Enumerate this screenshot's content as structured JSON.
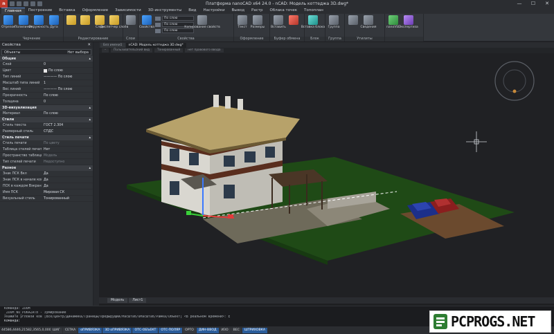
{
  "titlebar": {
    "title": "Платформа nanoCAD x64 24.0 - nCAD: Модель коттеджа 3D.dwg*",
    "app_icon": "nanocad-logo",
    "minimize": "—",
    "maximize": "☐",
    "close": "✕"
  },
  "ribbon_tabs": [
    "Главная",
    "Построение",
    "Вставка",
    "Оформление",
    "Зависимости",
    "3D-инструменты",
    "Вид",
    "Настройки",
    "Вывод",
    "Растр",
    "Облака точек",
    "Топоплан"
  ],
  "ribbon": {
    "groups": [
      {
        "label": "Черчение",
        "buttons": [
          {
            "label": "Отрезок",
            "icon": "line-icon",
            "color": "blue"
          },
          {
            "label": "Полилиния",
            "icon": "polyline-icon",
            "color": "blue"
          },
          {
            "label": "Окружность",
            "icon": "circle-icon",
            "color": "blue"
          },
          {
            "label": "Дуга",
            "icon": "arc-icon",
            "color": "blue"
          }
        ]
      },
      {
        "label": "Редактирование",
        "buttons": [
          {
            "label": "",
            "icon": "move-icon",
            "color": "yellow"
          },
          {
            "label": "",
            "icon": "rotate-icon",
            "color": "yellow"
          },
          {
            "label": "Слои",
            "icon": "layers-icon",
            "color": "yellow"
          },
          {
            "label": "Диспетчер слоёв",
            "icon": "layer-manager-icon",
            "color": "yellow"
          }
        ]
      },
      {
        "label": "Слои",
        "buttons": [
          {
            "label": "",
            "icon": "layer-props-icon",
            "color": "gray"
          }
        ]
      },
      {
        "label": "Свойства",
        "combos": [
          "По слою",
          "По слою",
          "По слою"
        ],
        "buttons": [
          {
            "label": "Свойства",
            "icon": "properties-icon",
            "color": "blue"
          },
          {
            "label": "Копирование свойств",
            "icon": "match-props-icon",
            "color": "gray"
          }
        ]
      },
      {
        "label": "Оформление",
        "buttons": [
          {
            "label": "Текст",
            "icon": "text-icon",
            "color": "gray"
          },
          {
            "label": "Размеры",
            "icon": "dimension-icon",
            "color": "gray"
          }
        ]
      },
      {
        "label": "Буфер обмена",
        "buttons": [
          {
            "label": "Вставить",
            "icon": "paste-icon",
            "color": "gray"
          },
          {
            "label": "",
            "icon": "cut-icon",
            "color": "red"
          }
        ]
      },
      {
        "label": "Блок",
        "buttons": [
          {
            "label": "Вставка блока",
            "icon": "insert-block-icon",
            "color": "teal"
          }
        ]
      },
      {
        "label": "Группа",
        "buttons": [
          {
            "label": "Группа",
            "icon": "group-icon",
            "color": "gray"
          }
        ]
      },
      {
        "label": "Утилиты",
        "buttons": [
          {
            "label": "",
            "icon": "measure-icon",
            "color": "gray"
          },
          {
            "label": "Сведения",
            "icon": "info-icon",
            "color": "gray"
          }
        ]
      },
      {
        "label": "",
        "buttons": [
          {
            "label": "nanoVSE",
            "icon": "nanovse-icon",
            "color": "green"
          },
          {
            "label": "Экспертиза",
            "icon": "expert-icon",
            "color": "purple"
          }
        ]
      }
    ]
  },
  "properties": {
    "header": "Свойства",
    "close": "✕",
    "selection": "Нет выбора",
    "selection_label": "Объекты",
    "sections": [
      {
        "title": "Общие",
        "rows": [
          {
            "k": "Слой",
            "v": "0"
          },
          {
            "k": "Цвет",
            "v": "По слою",
            "swatch": true
          },
          {
            "k": "Тип линий",
            "v": "———— По слою"
          },
          {
            "k": "Масштаб типа линий",
            "v": "1"
          },
          {
            "k": "Вес линий",
            "v": "———— По слою"
          },
          {
            "k": "Прозрачность",
            "v": "По слою"
          },
          {
            "k": "Толщина",
            "v": "0"
          }
        ]
      },
      {
        "title": "3D-визуализация",
        "rows": [
          {
            "k": "Материал",
            "v": "По слою"
          }
        ]
      },
      {
        "title": "Стили",
        "rows": [
          {
            "k": "Стиль текста",
            "v": "ГОСТ 2.304"
          },
          {
            "k": "Размерный стиль",
            "v": "СПДС"
          }
        ]
      },
      {
        "title": "Стиль печати",
        "rows": [
          {
            "k": "Стиль печати",
            "v": "По цвету",
            "dim": true
          },
          {
            "k": "Таблица стилей печати",
            "v": "Нет"
          },
          {
            "k": "Пространство таблицы ...",
            "v": "Модель",
            "dim": true
          },
          {
            "k": "Тип стилей печати",
            "v": "Недоступно",
            "dim": true
          }
        ]
      },
      {
        "title": "Разное",
        "rows": [
          {
            "k": "Знак ПСК Вкл",
            "v": "Да"
          },
          {
            "k": "Знак ПСК в начале коорд...",
            "v": "Да"
          },
          {
            "k": "ПСК в каждом Вэкране",
            "v": "Да"
          },
          {
            "k": "Имя ПСК",
            "v": "Мировая СК"
          },
          {
            "k": "Визуальный стиль",
            "v": "Тонированный"
          }
        ]
      }
    ]
  },
  "doc_tabs": [
    "Без имени1",
    "nCAD: Модель коттеджа 3D.dwg*"
  ],
  "view_bar": [
    "–",
    "Пользовательский вид",
    "Тонированный",
    "нет правового ввода"
  ],
  "layout_tabs": [
    "Модель",
    "Лист1"
  ],
  "command_lines": [
    "Команда: ZOOM",
    "_ZOOM_NO_PUKAZATb - Зумирование",
    "Укажите угловой ков [Все/Центр/Динамика/Границы/Предыдущий/Масштаб/ОМасштаб/Рамка/Объект] <В реальном времени>: E",
    "Команда:"
  ],
  "statusbar": {
    "coords": "44586,4446,21582,3565,0,000",
    "toggles": [
      {
        "label": "ШАГ",
        "on": false
      },
      {
        "label": "СЕТКА",
        "on": false
      },
      {
        "label": "оПРИВЯЗКА",
        "on": true
      },
      {
        "label": "3D оПРИВЯЗКА",
        "on": true
      },
      {
        "label": "ОТС-ОБЪЕКТ",
        "on": true
      },
      {
        "label": "ОТС-ПОЛЯР",
        "on": true
      },
      {
        "label": "ОРТО",
        "on": false
      },
      {
        "label": "ДИН-ВВОД",
        "on": true
      },
      {
        "label": "ИЗО",
        "on": false
      },
      {
        "label": "ВЕС",
        "on": false
      },
      {
        "label": "ШТРИХОВКА",
        "on": true
      }
    ],
    "model": "МОДЕЛЬ",
    "scale": "М1:100"
  },
  "watermark": {
    "text": "PCPROGS.NET"
  }
}
